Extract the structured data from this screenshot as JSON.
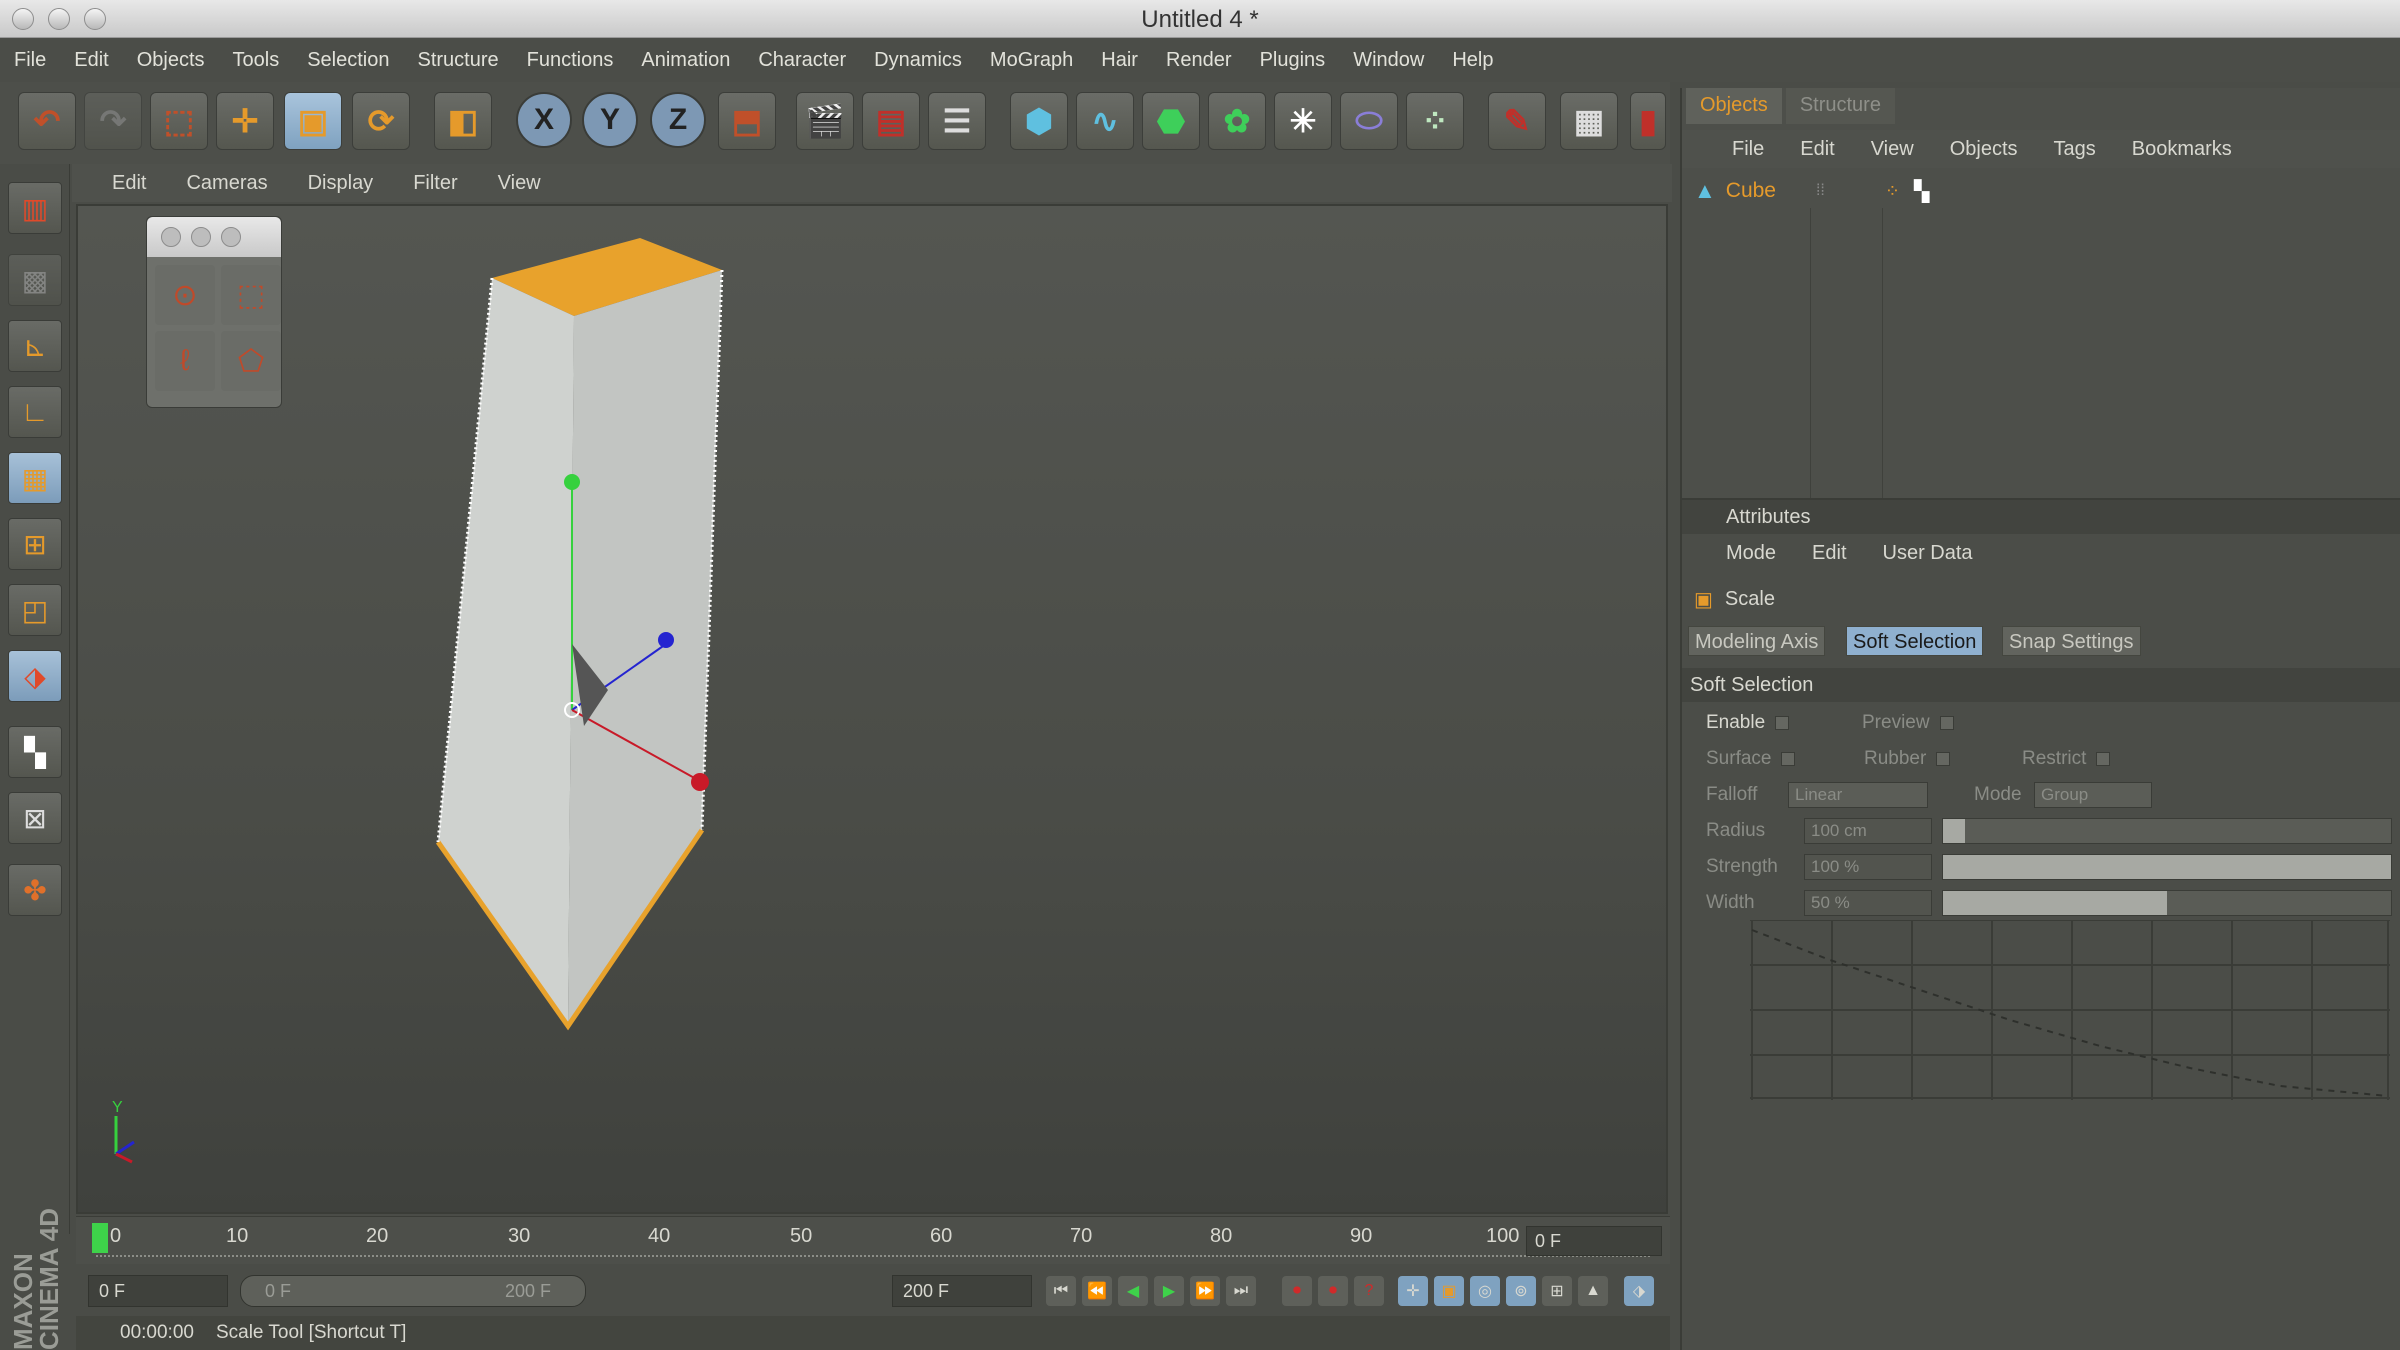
{
  "window": {
    "title": "Untitled 4 *"
  },
  "menu": [
    "File",
    "Edit",
    "Objects",
    "Tools",
    "Selection",
    "Structure",
    "Functions",
    "Animation",
    "Character",
    "Dynamics",
    "MoGraph",
    "Hair",
    "Render",
    "Plugins",
    "Window",
    "Help"
  ],
  "toolbar": {
    "undo_icon": "undo-icon",
    "axis_x": "X",
    "axis_y": "Y",
    "axis_z": "Z"
  },
  "viewport": {
    "menu": [
      "Edit",
      "Cameras",
      "Display",
      "Filter",
      "View"
    ],
    "axis_y_label": "Y"
  },
  "timeline": {
    "ticks": [
      "0",
      "10",
      "20",
      "30",
      "40",
      "50",
      "60",
      "70",
      "80",
      "90",
      "100"
    ],
    "current_frame": "0 F",
    "field_start": "0 F",
    "range_start": "0 F",
    "range_end": "200 F",
    "field_end": "200 F",
    "playhead_frame": 0
  },
  "status": {
    "time": "00:00:00",
    "message": "Scale Tool [Shortcut T]"
  },
  "brand": "MAXON CINEMA 4D",
  "objects_panel": {
    "tabs": [
      "Objects",
      "Structure"
    ],
    "menu": [
      "File",
      "Edit",
      "View",
      "Objects",
      "Tags",
      "Bookmarks"
    ],
    "object_name": "Cube"
  },
  "attributes": {
    "title": "Attributes",
    "menu": [
      "Mode",
      "Edit",
      "User Data"
    ],
    "tool_name": "Scale",
    "tabs": [
      "Modeling Axis",
      "Soft Selection",
      "Snap Settings"
    ],
    "active_tab": "Soft Selection",
    "section": "Soft Selection",
    "enable_label": "Enable",
    "preview_label": "Preview",
    "surface_label": "Surface",
    "rubber_label": "Rubber",
    "restrict_label": "Restrict",
    "falloff_label": "Falloff",
    "falloff_value": "Linear",
    "mode_label": "Mode",
    "mode_value": "Group",
    "radius_label": "Radius",
    "radius_value": "100 cm",
    "radius_fraction": 0.05,
    "strength_label": "Strength",
    "strength_value": "100 %",
    "strength_fraction": 1.0,
    "width_label": "Width",
    "width_value": "50 %",
    "width_fraction": 0.5
  },
  "colors": {
    "accent_orange": "#e59a2b",
    "selected_blue": "#8fb0cf",
    "axis_green": "#36d13e",
    "axis_blue": "#2424d0",
    "axis_red": "#c81a28"
  }
}
